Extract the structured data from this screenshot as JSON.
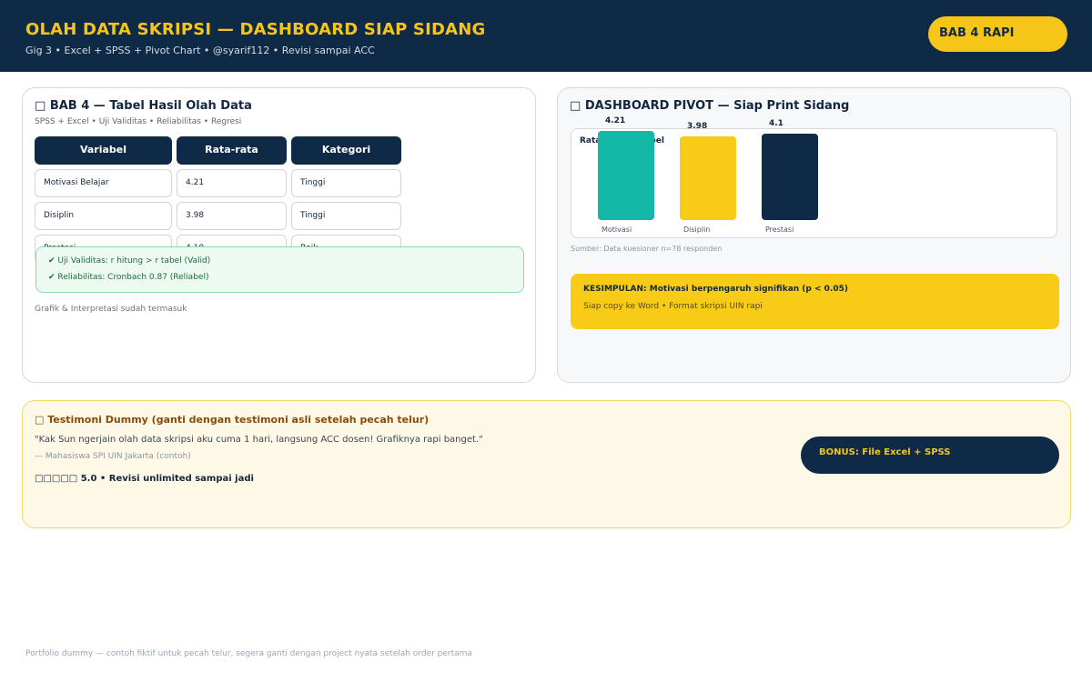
{
  "header": {
    "title": "OLAH DATA SKRIPSI — DASHBOARD SIAP SIDANG",
    "subtitle": "Gig 3 • Excel + SPSS + Pivot Chart  •  @syarif112  •  Revisi sampai ACC",
    "badge": "BAB 4 RAPI"
  },
  "left_card": {
    "icon": "□",
    "title": "BAB 4 — Tabel Hasil Olah Data",
    "subtitle": "SPSS + Excel • Uji Validitas • Reliabilitas • Regresi",
    "columns": [
      "Variabel",
      "Rata-rata",
      "Kategori"
    ],
    "rows": [
      [
        "Motivasi Belajar",
        "4.21",
        "Tinggi"
      ],
      [
        "Disiplin",
        "3.98",
        "Tinggi"
      ],
      [
        "Prestasi",
        "4.10",
        "Baik"
      ]
    ],
    "checks": [
      "✔ Uji Validitas: r hitung > r tabel (Valid)",
      "✔ Reliabilitas: Cronbach 0.87 (Reliabel)"
    ],
    "note": "Grafik & Interpretasi sudah termasuk"
  },
  "right_card": {
    "icon": "□",
    "title": "DASHBOARD PIVOT — Siap Print Sidang",
    "source": "Sumber: Data kuesioner n=78 responden",
    "conclusion_title": "KESIMPULAN: Motivasi berpengaruh signifikan (p < 0.05)",
    "conclusion_sub": "Siap copy ke Word • Format skripsi UIN rapi"
  },
  "chart_data": {
    "type": "bar",
    "title": "Rata-rata Variabel",
    "categories": [
      "Motivasi",
      "Disiplin",
      "Prestasi"
    ],
    "values": [
      4.21,
      3.98,
      4.1
    ],
    "value_labels": [
      "4.21",
      "3.98",
      "4.1"
    ],
    "colors": [
      "#13b8a6",
      "#f8cb16",
      "#0f2a47"
    ],
    "ylim": [
      0,
      4.4
    ],
    "grid": false
  },
  "testimonial": {
    "icon": "□",
    "title": "Testimoni Dummy (ganti dengan testimoni asli setelah pecah telur)",
    "quote": "\"Kak Sun ngerjain olah data skripsi aku cuma 1 hari, langsung ACC dosen! Grafiknya rapi banget.\"",
    "author": "— Mahasiswa SPI UIN Jakarta (contoh)",
    "rating": "□□□□□  5.0  •  Revisi unlimited sampai jadi",
    "bonus": "BONUS: File Excel + SPSS"
  },
  "footer": "Portfolio dummy — contoh fiktif untuk pecah telur, segera ganti dengan project nyata setelah order pertama"
}
